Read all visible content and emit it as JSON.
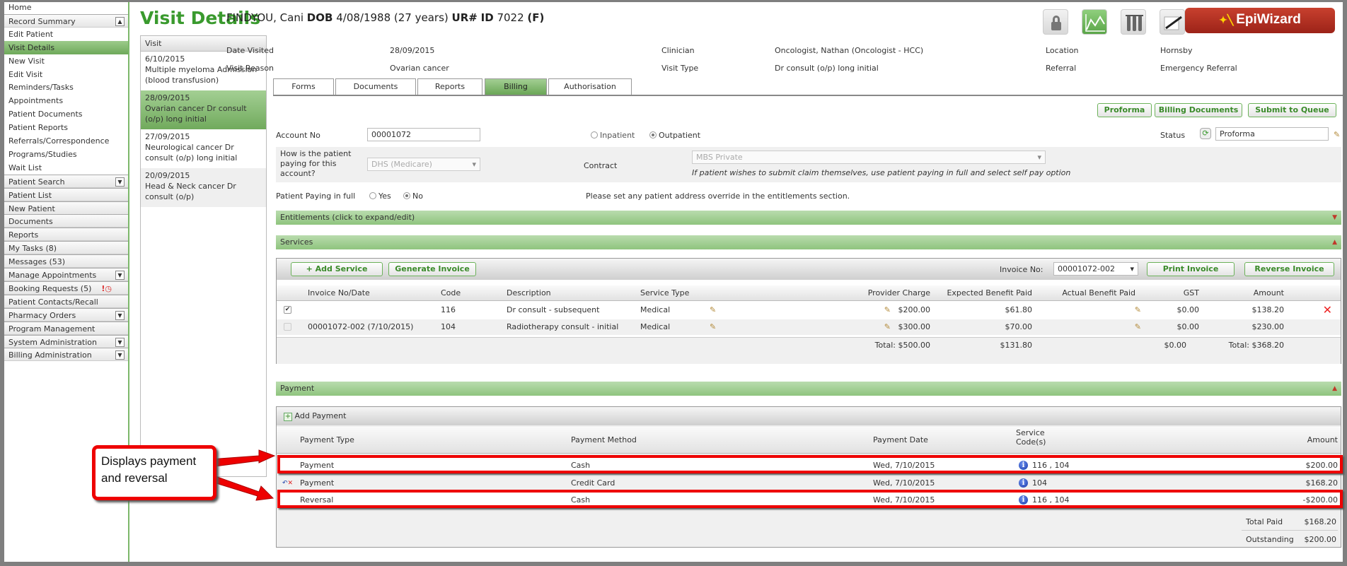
{
  "sidebar": {
    "items": [
      {
        "label": "Home",
        "type": "item"
      },
      {
        "label": "Record Summary",
        "type": "header",
        "chevron": "up"
      },
      {
        "label": "Edit Patient",
        "type": "item"
      },
      {
        "label": "Visit Details",
        "type": "item",
        "selected": true
      },
      {
        "label": "New Visit",
        "type": "item"
      },
      {
        "label": "Edit Visit",
        "type": "item"
      },
      {
        "label": "Reminders/Tasks",
        "type": "item"
      },
      {
        "label": "Appointments",
        "type": "item"
      },
      {
        "label": "Patient Documents",
        "type": "item"
      },
      {
        "label": "Patient Reports",
        "type": "item"
      },
      {
        "label": "Referrals/Correspondence",
        "type": "item"
      },
      {
        "label": "Programs/Studies",
        "type": "item"
      },
      {
        "label": "Wait List",
        "type": "item"
      },
      {
        "label": "Patient Search",
        "type": "header",
        "chevron": "down"
      },
      {
        "label": "Patient List",
        "type": "header"
      },
      {
        "label": "New Patient",
        "type": "header"
      },
      {
        "label": "Documents",
        "type": "header"
      },
      {
        "label": "Reports",
        "type": "header"
      },
      {
        "label": "My Tasks (8)",
        "type": "header"
      },
      {
        "label": "Messages (53)",
        "type": "header"
      },
      {
        "label": "Manage Appointments",
        "type": "header",
        "chevron": "down"
      },
      {
        "label": "Booking Requests (5)",
        "type": "header",
        "icon": "alert-clock-icon"
      },
      {
        "label": "Patient Contacts/Recall",
        "type": "header"
      },
      {
        "label": "Pharmacy Orders",
        "type": "header",
        "chevron": "down"
      },
      {
        "label": "Program Management",
        "type": "header"
      },
      {
        "label": "System Administration",
        "type": "header",
        "chevron": "down"
      },
      {
        "label": "Billing Administration",
        "type": "header",
        "chevron": "down"
      }
    ]
  },
  "page_title": "Visit Details",
  "visits": {
    "header": "Visit",
    "items": [
      {
        "date": "6/10/2015",
        "desc": "Multiple myeloma   Admission (blood transfusion)"
      },
      {
        "date": "28/09/2015",
        "desc": "Ovarian cancer   Dr consult (o/p) long initial",
        "selected": true
      },
      {
        "date": "27/09/2015",
        "desc": "Neurological cancer   Dr consult (o/p) long initial"
      },
      {
        "date": "20/09/2015",
        "desc": "Head & Neck cancer   Dr consult (o/p)"
      }
    ]
  },
  "patient": {
    "name": "FINDYOU, Cani",
    "dob_label": "DOB",
    "dob": "4/08/1988 (27 years)",
    "ur_label": "UR#",
    "id_label": "ID",
    "id": "7022",
    "sex": "(F)"
  },
  "toolbar_icons": [
    "lock-icon",
    "chart-icon",
    "test-tubes-icon",
    "sign-document-icon"
  ],
  "epiwizard_label": "EpiWizard",
  "visit_info": {
    "date_visited_label": "Date Visited",
    "date_visited": "28/09/2015",
    "clinician_label": "Clinician",
    "clinician": "Oncologist, Nathan (Oncologist - HCC)",
    "location_label": "Location",
    "location": "Hornsby",
    "visit_reason_label": "Visit Reason",
    "visit_reason": "Ovarian cancer",
    "visit_type_label": "Visit Type",
    "visit_type": "Dr consult (o/p) long initial",
    "referral_label": "Referral",
    "referral": "Emergency Referral"
  },
  "tabs": [
    {
      "label": "Forms"
    },
    {
      "label": "Documents"
    },
    {
      "label": "Reports"
    },
    {
      "label": "Billing",
      "active": true
    },
    {
      "label": "Authorisation"
    }
  ],
  "billing": {
    "buttons": {
      "proforma": "Proforma",
      "billing_documents": "Billing Documents",
      "submit": "Submit to Queue"
    },
    "account_no_label": "Account No",
    "account_no": "00001072",
    "inpatient_label": "Inpatient",
    "outpatient_label": "Outpatient",
    "patient_class": "Outpatient",
    "status_label": "Status",
    "status": "Proforma",
    "paying_label": "How is the patient paying for this account?",
    "paying": "DHS (Medicare)",
    "contract_label": "Contract",
    "contract": "MBS Private",
    "contract_note": "If patient wishes to submit claim themselves, use patient paying in full and select self pay option",
    "paying_full_label": "Patient Paying in full",
    "yes_label": "Yes",
    "no_label": "No",
    "paying_full": "No",
    "address_note": "Please set any patient address override in the entitlements section.",
    "entitlements_label": "Entitlements (click to expand/edit)",
    "services_label": "Services",
    "payment_label": "Payment"
  },
  "services": {
    "add_service": "+ Add Service",
    "generate_invoice": "Generate Invoice",
    "invoice_no_label": "Invoice No:",
    "invoice_no": "00001072-002",
    "print_invoice": "Print Invoice",
    "reverse_invoice": "Reverse Invoice",
    "columns": [
      "Invoice No/Date",
      "Code",
      "Description",
      "Service Type",
      "Provider Charge",
      "Expected Benefit Paid",
      "Actual Benefit Paid",
      "GST",
      "Amount"
    ],
    "rows": [
      {
        "checked": true,
        "invoice": "",
        "code": "116",
        "description": "Dr consult - subsequent",
        "type": "Medical",
        "provider": "$200.00",
        "expected": "$61.80",
        "actual": "",
        "gst": "$0.00",
        "amount": "$138.20"
      },
      {
        "checked": false,
        "invoice": "00001072-002 (7/10/2015)",
        "code": "104",
        "description": "Radiotherapy consult - initial",
        "type": "Medical",
        "provider": "$300.00",
        "expected": "$70.00",
        "actual": "",
        "gst": "$0.00",
        "amount": "$230.00"
      }
    ],
    "totals": {
      "provider": "Total: $500.00",
      "expected": "$131.80",
      "gst": "$0.00",
      "amount": "Total: $368.20"
    }
  },
  "payments": {
    "add_payment": "Add Payment",
    "columns": [
      "Payment Type",
      "Payment Method",
      "Payment Date",
      "Service Code(s)",
      "Amount"
    ],
    "rows": [
      {
        "type": "Payment",
        "method": "Cash",
        "date": "Wed, 7/10/2015",
        "codes": "116 , 104",
        "amount": "$200.00",
        "highlight": true
      },
      {
        "type": "Payment",
        "method": "Credit Card",
        "date": "Wed, 7/10/2015",
        "codes": "104",
        "amount": "$168.20",
        "reversed_icon": true
      },
      {
        "type": "Reversal",
        "method": "Cash",
        "date": "Wed, 7/10/2015",
        "codes": "116 , 104",
        "amount": "-$200.00",
        "highlight": true
      }
    ],
    "total_paid_label": "Total Paid",
    "total_paid": "$168.20",
    "outstanding_label": "Outstanding",
    "outstanding": "$200.00"
  },
  "annotation": {
    "text": "Displays payment and reversal",
    "color": "#ee0000"
  },
  "colors": {
    "accent_green": "#3a9a2e",
    "epiwizard": "#b0301f",
    "highlight": "#ee0000"
  }
}
